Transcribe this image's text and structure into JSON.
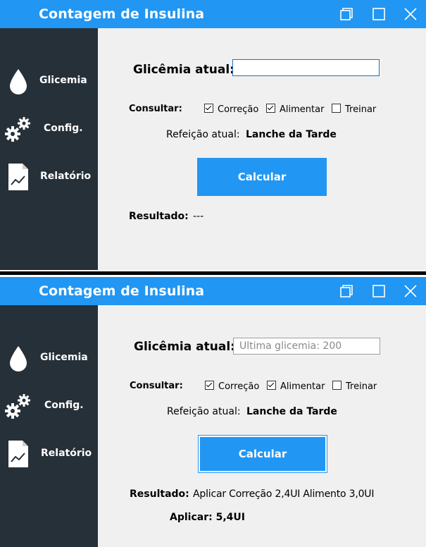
{
  "windows": [
    {
      "title": "Contagem de Insulina",
      "sidebar": [
        "Glicemia",
        "Config.",
        "Relatório"
      ],
      "glicemia_label": "Glicêmia atual:",
      "glicemia_value": "",
      "glicemia_placeholder": "",
      "consultar_label": "Consultar:",
      "checkboxes": [
        {
          "label": "Correção",
          "checked": true
        },
        {
          "label": "Alimentar",
          "checked": true
        },
        {
          "label": "Treinar",
          "checked": false
        }
      ],
      "refeicao_label": "Refeição atual:",
      "refeicao_value": "Lanche da Tarde",
      "calcular_label": "Calcular",
      "resultado_label": "Resultado:",
      "resultado_value": "---",
      "aplicar_text": ""
    },
    {
      "title": "Contagem de Insulina",
      "sidebar": [
        "Glicemia",
        "Config.",
        "Relatório"
      ],
      "glicemia_label": "Glicêmia atual:",
      "glicemia_value": "",
      "glicemia_placeholder": "Ultima glicemia: 200",
      "consultar_label": "Consultar:",
      "checkboxes": [
        {
          "label": "Correção",
          "checked": true
        },
        {
          "label": "Alimentar",
          "checked": true
        },
        {
          "label": "Treinar",
          "checked": false
        }
      ],
      "refeicao_label": "Refeição atual:",
      "refeicao_value": "Lanche da Tarde",
      "calcular_label": "Calcular",
      "resultado_label": "Resultado:",
      "resultado_value": "Aplicar Correção 2,4UI  Alimento 3,0UI",
      "aplicar_text": "Aplicar: 5,4UI"
    }
  ],
  "colors": {
    "accent": "#2196f3",
    "sidebar": "#263038",
    "content_bg": "#f0f0f0"
  },
  "icons": {
    "window_controls": [
      "restore-icon",
      "maximize-icon",
      "close-icon"
    ],
    "nav": [
      "drop-icon",
      "gears-icon",
      "report-icon"
    ]
  }
}
